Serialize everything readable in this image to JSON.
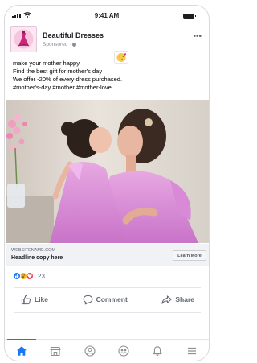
{
  "status_bar": {
    "time": "9:41 AM"
  },
  "post": {
    "page_name": "Beautiful Dresses",
    "sponsored_label": "Sponsored",
    "sponsored_separator": " · ",
    "caption_lines": [
      "make your mother happy.",
      "Find the best gift for mother's day",
      "We offer -20% of every dress purchased.",
      "#mother's-day #mother #mother-love"
    ]
  },
  "link": {
    "domain": "WEBSITENAME.COM",
    "headline": "Headline copy here",
    "cta_label": "Learn More"
  },
  "reactions": {
    "count": "23"
  },
  "actions": {
    "like_label": "Like",
    "comment_label": "Comment",
    "share_label": "Share"
  },
  "colors": {
    "accent": "#1877f2",
    "like": "#1877f2",
    "love": "#f33e58",
    "wow": "#f7b125"
  },
  "nav": {
    "items": [
      "home-icon",
      "marketplace-icon",
      "profile-icon",
      "groups-icon",
      "notifications-icon",
      "menu-icon"
    ],
    "active": "home-icon"
  }
}
